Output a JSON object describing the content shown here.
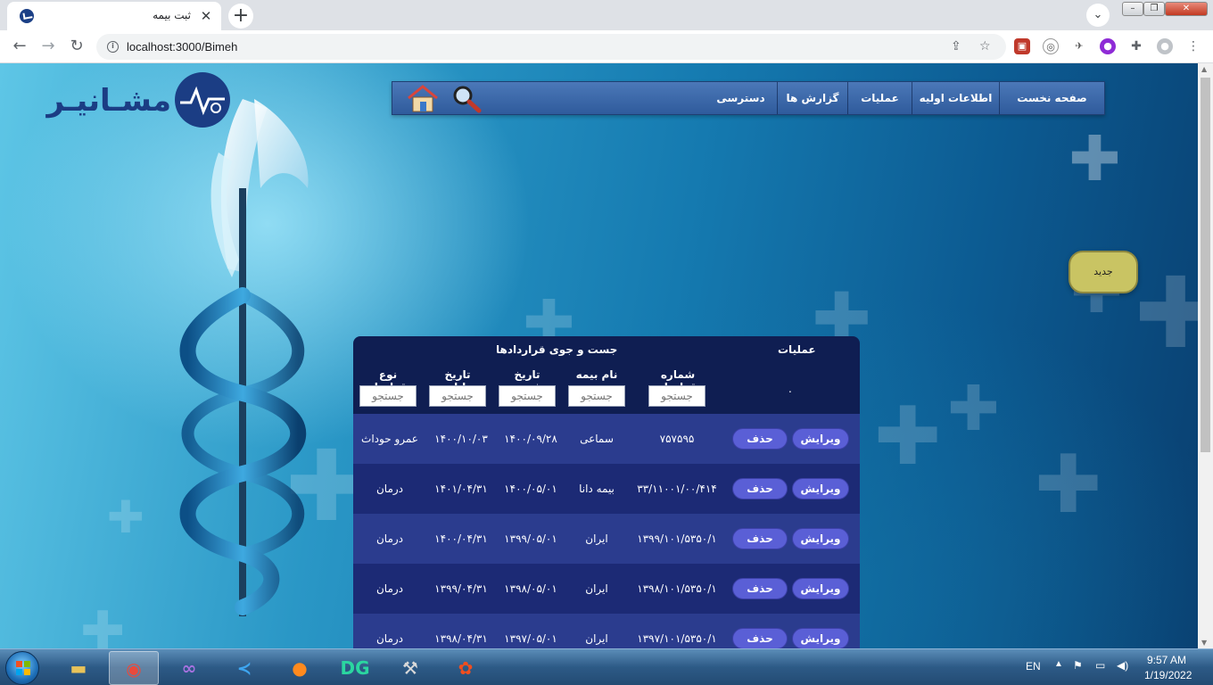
{
  "browser": {
    "tab_title": "ثبت بیمه",
    "tab_close": "✕",
    "new_tab": "+",
    "url": "localhost:3000/Bimeh"
  },
  "site": {
    "logo_text": "مشـانیـر"
  },
  "nav": {
    "items": [
      "صفحه نخست",
      "اطلاعات اولیه",
      "عملیات",
      "گزارش ها",
      "دسترسی"
    ]
  },
  "new_button": "جدید",
  "grid": {
    "operations_header": "عملیات",
    "search_header": "جست و جوی قراردادها",
    "dot": ".",
    "columns": [
      "شماره قرارداد",
      "نام بیمه",
      "تاریخ شروع",
      "تاریخ پایان",
      "نوع قرارداد"
    ],
    "search_placeholder": "جستجو",
    "edit_label": "ویرایش",
    "delete_label": "حذف",
    "rows": [
      {
        "contract_no": "۷۵۷۵۹۵",
        "insurer": "سماعی",
        "start": "۱۴۰۰/۰۹/۲۸",
        "end": "۱۴۰۰/۱۰/۰۳",
        "type": "عمرو حوداث"
      },
      {
        "contract_no": "۳۳/۱۱۰۰۱/۰۰/۴۱۴",
        "insurer": "بیمه دانا",
        "start": "۱۴۰۰/۰۵/۰۱",
        "end": "۱۴۰۱/۰۴/۳۱",
        "type": "درمان"
      },
      {
        "contract_no": "۱۳۹۹/۱۰۱/۵۳۵۰/۱",
        "insurer": "ایران",
        "start": "۱۳۹۹/۰۵/۰۱",
        "end": "۱۴۰۰/۰۴/۳۱",
        "type": "درمان"
      },
      {
        "contract_no": "۱۳۹۸/۱۰۱/۵۳۵۰/۱",
        "insurer": "ایران",
        "start": "۱۳۹۸/۰۵/۰۱",
        "end": "۱۳۹۹/۰۴/۳۱",
        "type": "درمان"
      },
      {
        "contract_no": "۱۳۹۷/۱۰۱/۵۳۵۰/۱",
        "insurer": "ایران",
        "start": "۱۳۹۷/۰۵/۰۱",
        "end": "۱۳۹۸/۰۴/۳۱",
        "type": "درمان"
      }
    ]
  },
  "taskbar": {
    "apps": [
      {
        "name": "file-explorer",
        "glyph": "▬",
        "color": "#e8c35a"
      },
      {
        "name": "chrome",
        "glyph": "◉",
        "color": "#e84a3c"
      },
      {
        "name": "visual-studio",
        "glyph": "∞",
        "color": "#a772e0"
      },
      {
        "name": "vscode",
        "glyph": "≺",
        "color": "#3ea6f0"
      },
      {
        "name": "firefox",
        "glyph": "●",
        "color": "#ff8a1e"
      },
      {
        "name": "datagrip",
        "glyph": "DG",
        "color": "#2bd6a0"
      },
      {
        "name": "build-tools",
        "glyph": "⚒",
        "color": "#d9d9d9"
      },
      {
        "name": "figma",
        "glyph": "✿",
        "color": "#f24e1e"
      }
    ],
    "lang": "EN",
    "time": "9:57 AM",
    "date": "1/19/2022"
  }
}
